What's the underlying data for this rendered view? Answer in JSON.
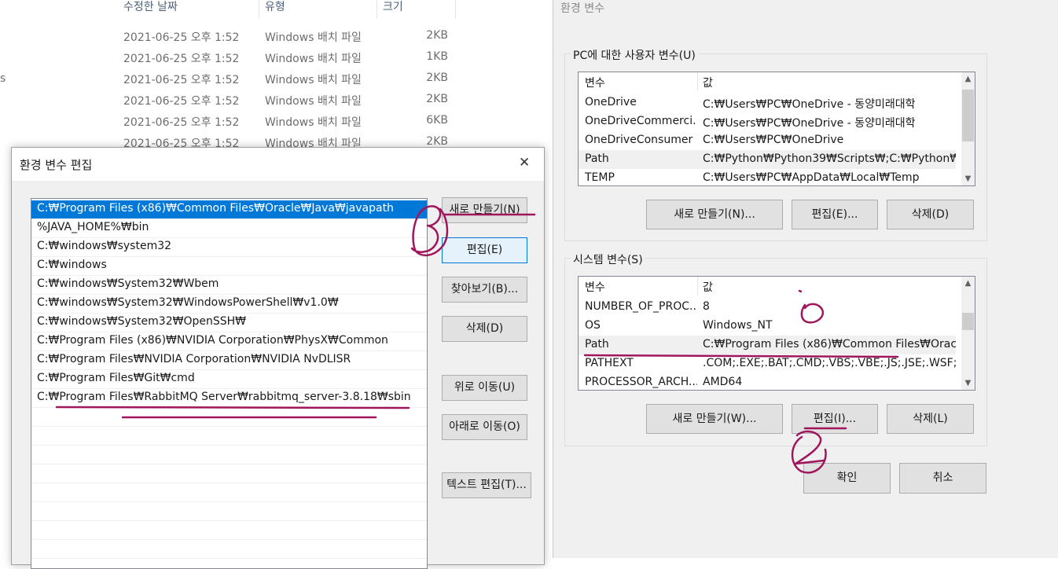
{
  "explorer": {
    "columns": [
      "수정한 날짜",
      "유형",
      "크기"
    ],
    "left_edge_glyph": "s",
    "files": [
      {
        "date": "2021-06-25 오후 1:52",
        "type": "Windows 배치 파일",
        "size": "2KB"
      },
      {
        "date": "2021-06-25 오후 1:52",
        "type": "Windows 배치 파일",
        "size": "1KB"
      },
      {
        "date": "2021-06-25 오후 1:52",
        "type": "Windows 배치 파일",
        "size": "2KB"
      },
      {
        "date": "2021-06-25 오후 1:52",
        "type": "Windows 배치 파일",
        "size": "2KB"
      },
      {
        "date": "2021-06-25 오후 1:52",
        "type": "Windows 배치 파일",
        "size": "6KB"
      },
      {
        "date": "2021-06-25 오후 1:52",
        "type": "Windows 배치 파일",
        "size": "2KB"
      }
    ]
  },
  "env_window": {
    "title": "환경 변수",
    "user_group_label": "PC에 대한 사용자 변수(U)",
    "user_headers": {
      "name": "변수",
      "value": "값"
    },
    "user_vars": [
      {
        "name": "OneDrive",
        "value": "C:₩Users₩PC₩OneDrive - 동양미래대학"
      },
      {
        "name": "OneDriveCommerci...",
        "value": "C:₩Users₩PC₩OneDrive - 동양미래대학"
      },
      {
        "name": "OneDriveConsumer",
        "value": "C:₩Users₩PC₩OneDrive"
      },
      {
        "name": "Path",
        "value": "C:₩Python₩Python39₩Scripts₩;C:₩Python₩P..."
      },
      {
        "name": "TEMP",
        "value": "C:₩Users₩PC₩AppData₩Local₩Temp"
      }
    ],
    "user_buttons": {
      "new": "새로 만들기(N)...",
      "edit": "편집(E)...",
      "delete": "삭제(D)"
    },
    "system_group_label": "시스템 변수(S)",
    "system_headers": {
      "name": "변수",
      "value": "값"
    },
    "system_vars": [
      {
        "name": "NUMBER_OF_PROC...",
        "value": "8"
      },
      {
        "name": "OS",
        "value": "Windows_NT"
      },
      {
        "name": "Path",
        "value": "C:₩Program Files (x86)₩Common Files₩Orac..."
      },
      {
        "name": "PATHEXT",
        "value": ".COM;.EXE;.BAT;.CMD;.VBS;.VBE;.JS;.JSE;.WSF;...."
      },
      {
        "name": "PROCESSOR_ARCH...",
        "value": "AMD64"
      }
    ],
    "system_buttons": {
      "new": "새로 만들기(W)...",
      "edit": "편집(I)...",
      "delete": "삭제(L)"
    },
    "ok": "확인",
    "cancel": "취소"
  },
  "edit_dialog": {
    "title": "환경 변수 편집",
    "close_glyph": "✕",
    "paths": [
      "C:₩Program Files (x86)₩Common Files₩Oracle₩Java₩javapath",
      "%JAVA_HOME%₩bin",
      "C:₩windows₩system32",
      "C:₩windows",
      "C:₩windows₩System32₩Wbem",
      "C:₩windows₩System32₩WindowsPowerShell₩v1.0₩",
      "C:₩windows₩System32₩OpenSSH₩",
      "C:₩Program Files (x86)₩NVIDIA Corporation₩PhysX₩Common",
      "C:₩Program Files₩NVIDIA Corporation₩NVIDIA NvDLISR",
      "C:₩Program Files₩Git₩cmd",
      "C:₩Program Files₩RabbitMQ Server₩rabbitmq_server-3.8.18₩sbin"
    ],
    "buttons": {
      "new": "새로 만들기(N)",
      "edit": "편집(E)",
      "browse": "찾아보기(B)...",
      "delete": "삭제(D)",
      "move_up": "위로 이동(U)",
      "move_down": "아래로 이동(O)",
      "text_edit": "텍스트 편집(T)..."
    }
  },
  "annotation_color": "#a0165c"
}
